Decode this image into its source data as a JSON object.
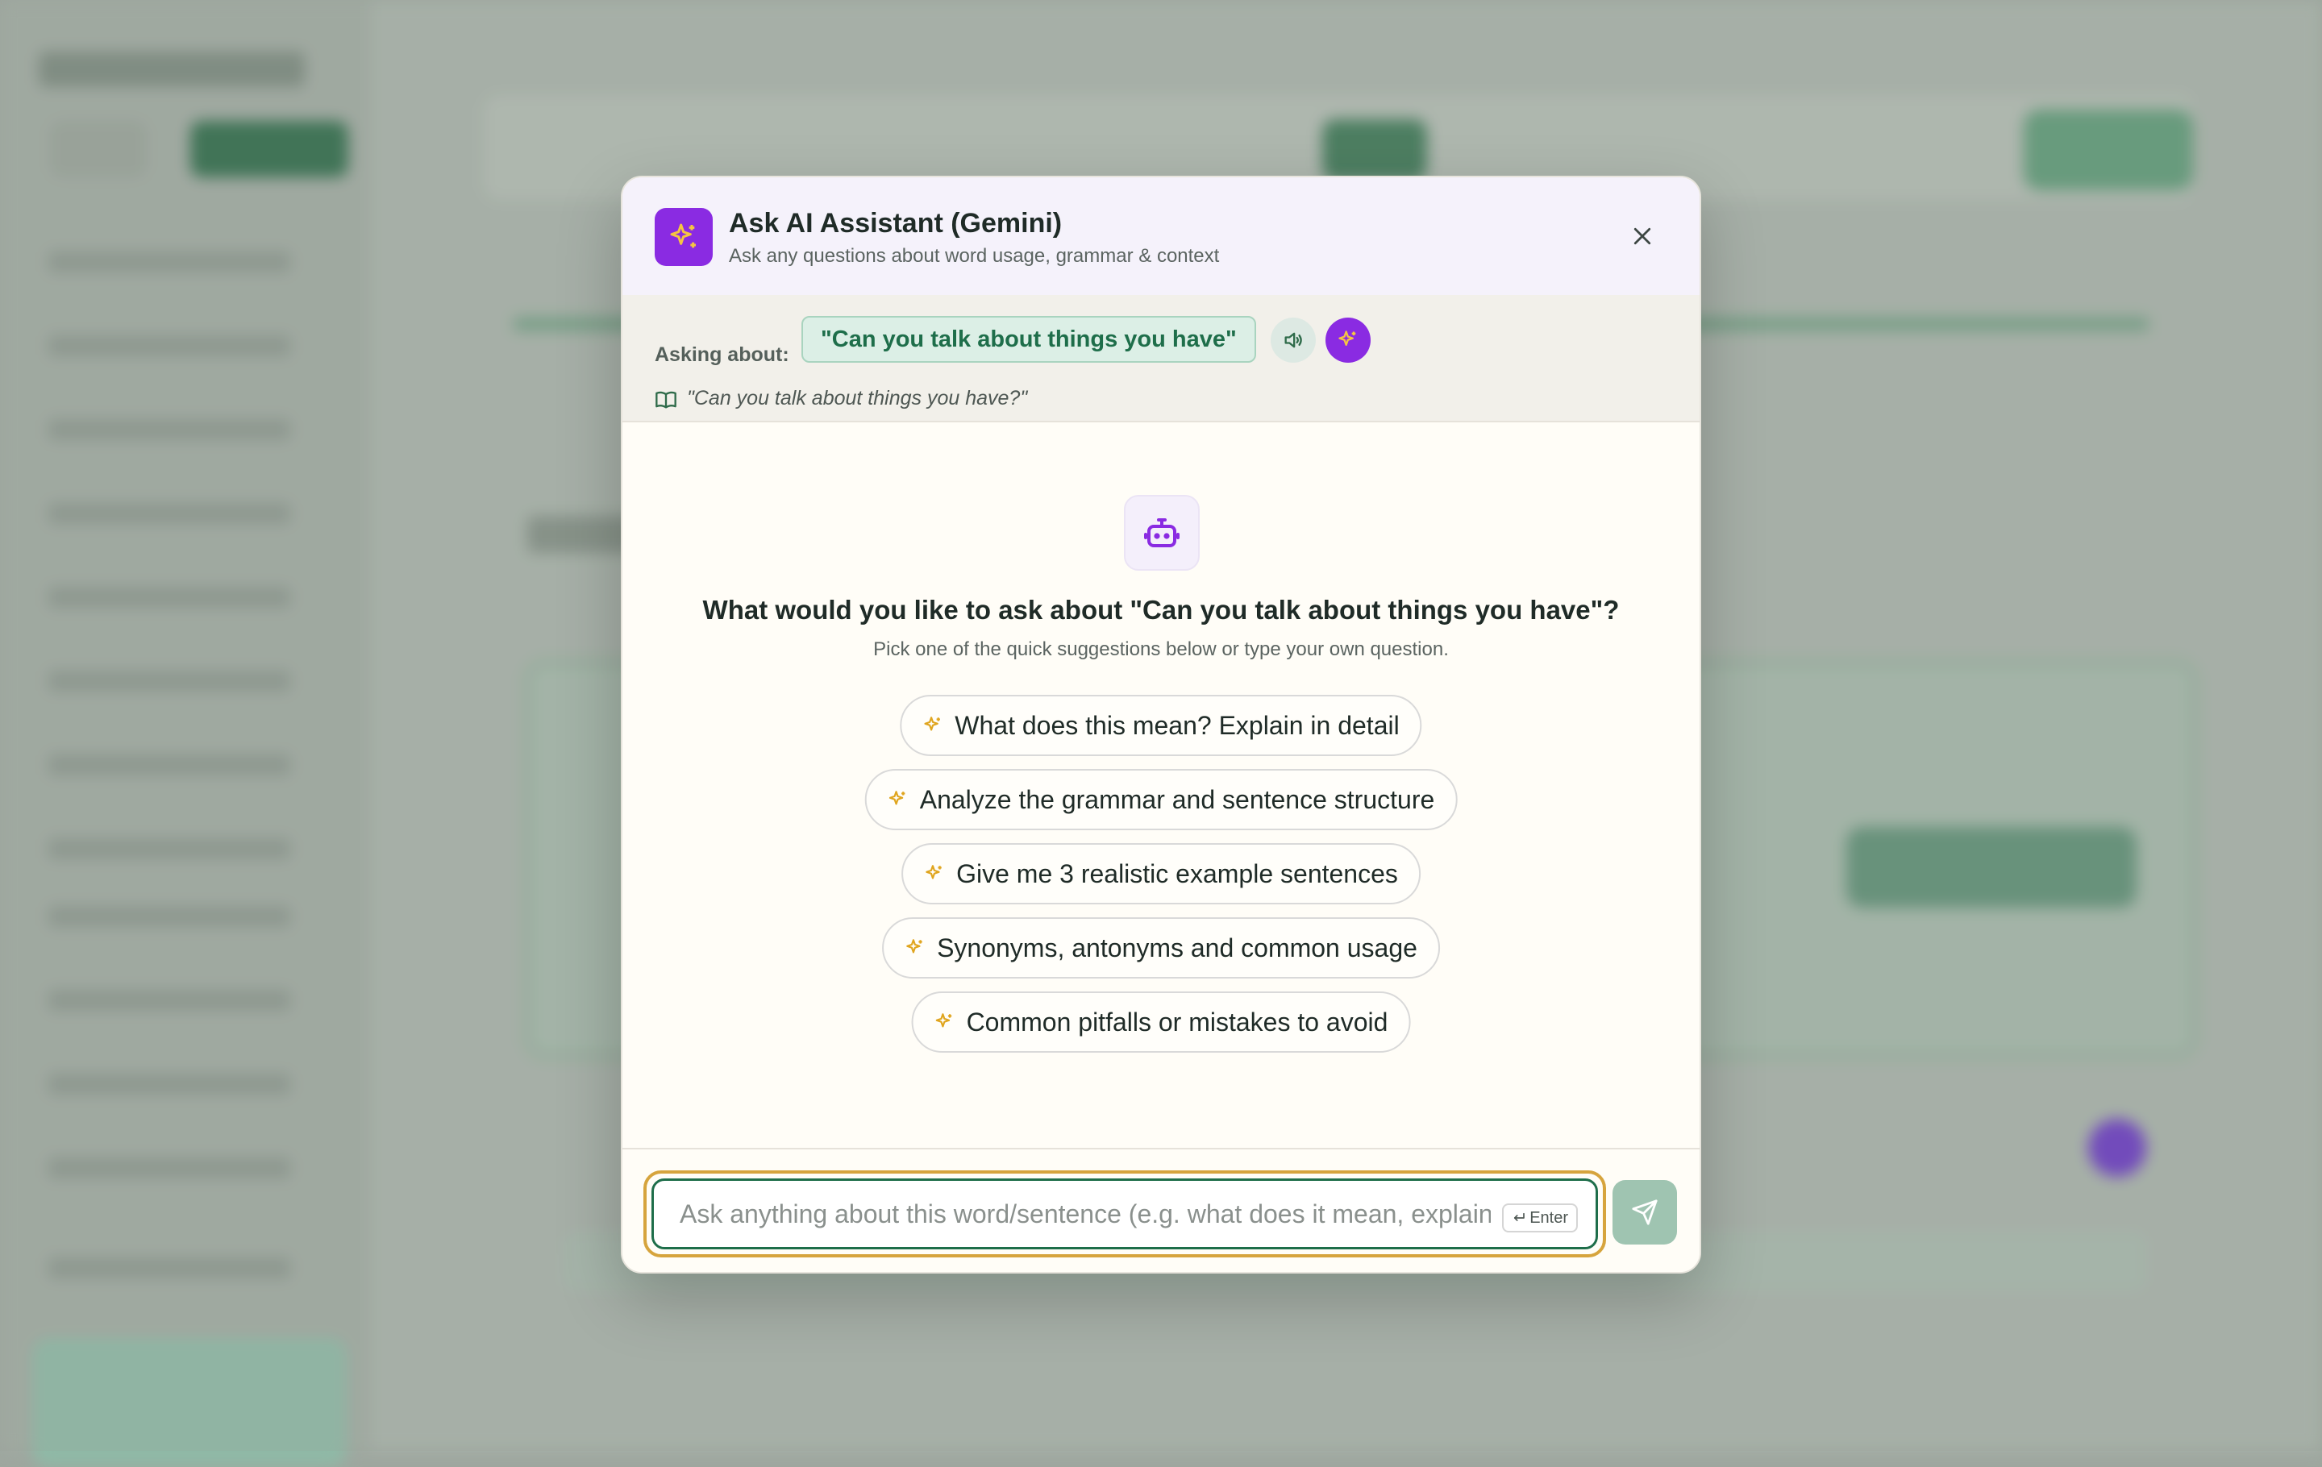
{
  "modal": {
    "title": "Ask AI Assistant (Gemini)",
    "subtitle": "Ask any questions about word usage, grammar & context",
    "close_icon": "close-icon",
    "header_icon": "sparkles-icon"
  },
  "asking": {
    "label": "Asking about:",
    "phrase": "\"Can you talk about things you have\"",
    "sentence": "\"Can you talk about things you have?\"",
    "speak_icon": "speaker-icon",
    "ai_icon": "sparkles-icon",
    "sentence_icon": "book-icon"
  },
  "empty_state": {
    "icon": "bot-icon",
    "question": "What would you like to ask about \"Can you talk about things you have\"?",
    "hint": "Pick one of the quick suggestions below or type your own question."
  },
  "suggestions": [
    "What does this mean? Explain in detail",
    "Analyze the grammar and sentence structure",
    "Give me 3 realistic example sentences",
    "Synonyms, antonyms and common usage",
    "Common pitfalls or mistakes to avoid"
  ],
  "composer": {
    "placeholder": "Ask anything about this word/sentence (e.g. what does it mean, explain grammar...)",
    "enter_hint": "Enter",
    "send_icon": "send-icon"
  },
  "colors": {
    "accent_purple": "#8a2be2",
    "accent_green": "#1e6e4a",
    "sparkle_yellow": "#e0a51e",
    "focus_ring": "#d6a43d"
  }
}
